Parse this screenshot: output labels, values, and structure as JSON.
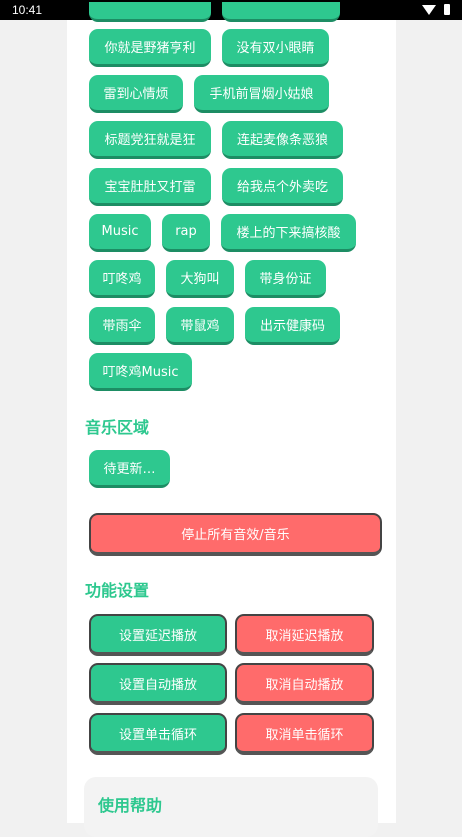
{
  "status": {
    "time": "10:41"
  },
  "sound_buttons_top": [
    "",
    ""
  ],
  "sound_buttons": [
    [
      "你就是野猪亨利",
      "没有双小眼睛"
    ],
    [
      "雷到心情烦",
      "手机前冒烟小姑娘"
    ],
    [
      "标题党狂就是狂",
      "连起麦像条恶狼"
    ],
    [
      "宝宝肚肚又打雷",
      "给我点个外卖吃"
    ],
    [
      "Music",
      "rap",
      "楼上的下来搞核酸"
    ],
    [
      "叮咚鸡",
      "大狗叫",
      "带身份证"
    ],
    [
      "带雨伞",
      "带鼠鸡",
      "出示健康码"
    ],
    [
      "叮咚鸡Music"
    ]
  ],
  "music_section": {
    "title": "音乐区域",
    "pending": "待更新…"
  },
  "stop_all": "停止所有音效/音乐",
  "settings": {
    "title": "功能设置",
    "rows": [
      {
        "set": "设置延迟播放",
        "cancel": "取消延迟播放"
      },
      {
        "set": "设置自动播放",
        "cancel": "取消自动播放"
      },
      {
        "set": "设置单击循环",
        "cancel": "取消单击循环"
      }
    ]
  },
  "help": {
    "title": "使用帮助"
  },
  "colors": {
    "primary": "#2ec88f",
    "danger": "#ff6b6b"
  }
}
